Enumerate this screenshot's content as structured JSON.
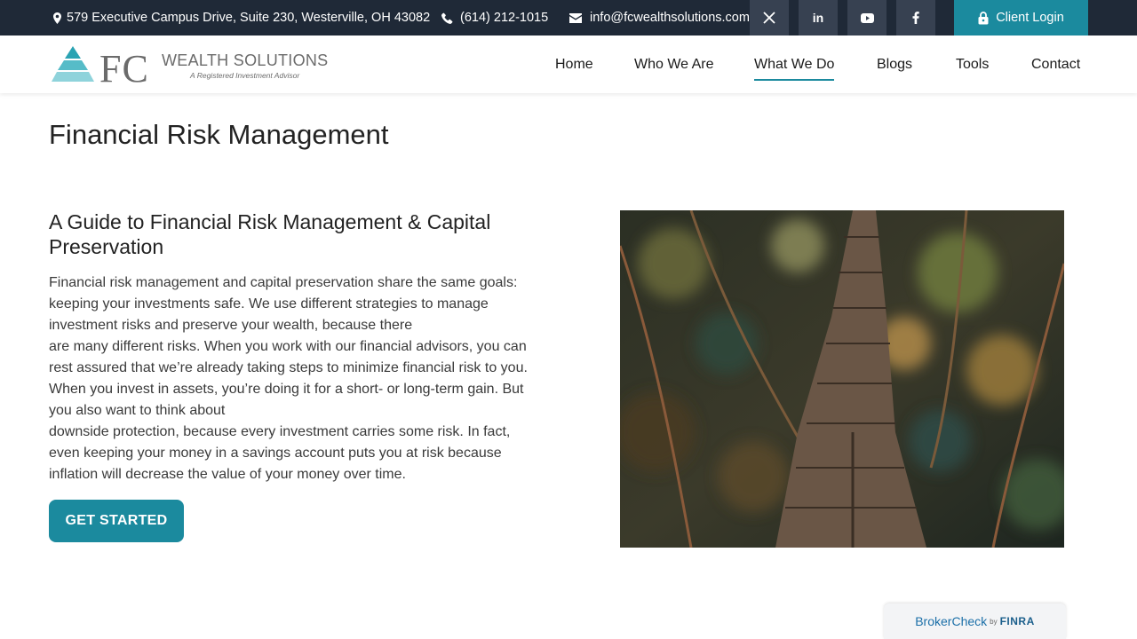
{
  "topbar": {
    "address": "579 Executive Campus Drive, Suite 230, Westerville, OH 43082",
    "phone": "(614) 212-1015",
    "email": "info@fcwealthsolutions.com",
    "social": {
      "linkedin": "in"
    },
    "client_login": "Client Login"
  },
  "logo": {
    "mark": "FC",
    "name": "WEALTH SOLUTIONS",
    "tagline": "A Registered Investment Advisor"
  },
  "nav": {
    "items": [
      {
        "label": "Home"
      },
      {
        "label": "Who We Are"
      },
      {
        "label": "What We Do"
      },
      {
        "label": "Blogs"
      },
      {
        "label": "Tools"
      },
      {
        "label": "Contact"
      }
    ],
    "active": "What We Do"
  },
  "main": {
    "page_title": "Financial Risk Management",
    "section_title": "A Guide to Financial Risk Management & Capital Preservation",
    "lines": [
      "Financial risk management and capital preservation share the same goals:",
      "keeping your investments safe. We use different strategies to manage",
      "investment risks and preserve your wealth, because there",
      "are many different risks. When you work with our financial advisors, you can",
      "rest assured that we’re already taking steps to minimize financial risk to you.",
      "When you invest in assets, you’re doing it for a short- or long-term gain. But",
      "you also want to think about",
      "downside protection, because every investment carries some risk. In fact,",
      "even keeping your money in a savings account puts you at risk because",
      "inflation will decrease the value of your money over time."
    ],
    "cta_label": "GET STARTED"
  },
  "brokercheck": {
    "label": "BrokerCheck",
    "by": "by",
    "finra": "FINRA"
  },
  "colors": {
    "topbar": "#1f2937",
    "accent": "#1b8a9e",
    "social_bg": "#374151"
  },
  "icons": {
    "address": "map-pin-icon",
    "phone": "phone-icon",
    "email": "envelope-icon",
    "social": [
      "x-twitter-icon",
      "linkedin-icon",
      "youtube-icon",
      "facebook-icon"
    ],
    "login": "lock-icon"
  }
}
